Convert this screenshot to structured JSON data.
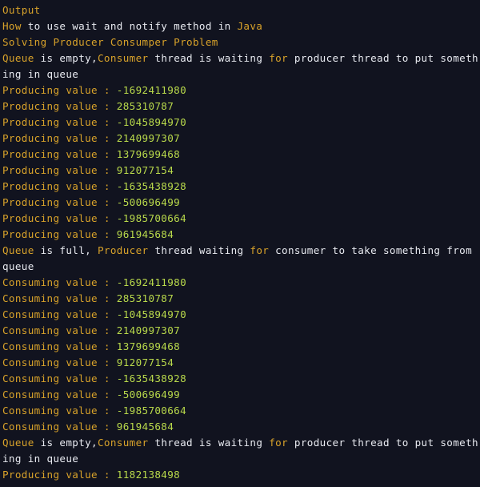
{
  "window": {
    "title": "Output",
    "background_color": "#11131f"
  },
  "colors": {
    "keyword": "#d8a22a",
    "plain": "#e8eaf0",
    "number": "#b9d94b",
    "background": "#11131f"
  },
  "console": {
    "label": "Output",
    "lines": [
      {
        "id": "line-output-label",
        "segments": [
          {
            "text": "Output",
            "style": "key"
          }
        ]
      },
      {
        "id": "line-title",
        "segments": [
          {
            "text": "How",
            "style": "key"
          },
          {
            "text": " to use wait and notify method in ",
            "style": "plain"
          },
          {
            "text": "Java",
            "style": "key"
          }
        ]
      },
      {
        "id": "line-subtitle",
        "segments": [
          {
            "text": "Solving Producer Consumper Problem",
            "style": "key"
          }
        ]
      },
      {
        "id": "line-queue-empty-1",
        "segments": [
          {
            "text": "Queue",
            "style": "key"
          },
          {
            "text": " is empty,",
            "style": "plain"
          },
          {
            "text": "Consumer",
            "style": "key"
          },
          {
            "text": " thread is waiting ",
            "style": "plain"
          },
          {
            "text": "for",
            "style": "key"
          },
          {
            "text": " producer thread to put something in queue",
            "style": "plain"
          }
        ]
      },
      {
        "id": "line-producing-1",
        "segments": [
          {
            "text": "Producing value : ",
            "style": "key"
          },
          {
            "text": "-1692411980",
            "style": "num"
          }
        ]
      },
      {
        "id": "line-producing-2",
        "segments": [
          {
            "text": "Producing value : ",
            "style": "key"
          },
          {
            "text": "285310787",
            "style": "num"
          }
        ]
      },
      {
        "id": "line-producing-3",
        "segments": [
          {
            "text": "Producing value : ",
            "style": "key"
          },
          {
            "text": "-1045894970",
            "style": "num"
          }
        ]
      },
      {
        "id": "line-producing-4",
        "segments": [
          {
            "text": "Producing value : ",
            "style": "key"
          },
          {
            "text": "2140997307",
            "style": "num"
          }
        ]
      },
      {
        "id": "line-producing-5",
        "segments": [
          {
            "text": "Producing value : ",
            "style": "key"
          },
          {
            "text": "1379699468",
            "style": "num"
          }
        ]
      },
      {
        "id": "line-producing-6",
        "segments": [
          {
            "text": "Producing value : ",
            "style": "key"
          },
          {
            "text": "912077154",
            "style": "num"
          }
        ]
      },
      {
        "id": "line-producing-7",
        "segments": [
          {
            "text": "Producing value : ",
            "style": "key"
          },
          {
            "text": "-1635438928",
            "style": "num"
          }
        ]
      },
      {
        "id": "line-producing-8",
        "segments": [
          {
            "text": "Producing value : ",
            "style": "key"
          },
          {
            "text": "-500696499",
            "style": "num"
          }
        ]
      },
      {
        "id": "line-producing-9",
        "segments": [
          {
            "text": "Producing value : ",
            "style": "key"
          },
          {
            "text": "-1985700664",
            "style": "num"
          }
        ]
      },
      {
        "id": "line-producing-10",
        "segments": [
          {
            "text": "Producing value : ",
            "style": "key"
          },
          {
            "text": "961945684",
            "style": "num"
          }
        ]
      },
      {
        "id": "line-queue-full",
        "segments": [
          {
            "text": "Queue",
            "style": "key"
          },
          {
            "text": " is full, ",
            "style": "plain"
          },
          {
            "text": "Producer",
            "style": "key"
          },
          {
            "text": " thread waiting ",
            "style": "plain"
          },
          {
            "text": "for",
            "style": "key"
          },
          {
            "text": " consumer to take something from queue",
            "style": "plain"
          }
        ]
      },
      {
        "id": "line-consuming-1",
        "segments": [
          {
            "text": "Consuming value : ",
            "style": "key"
          },
          {
            "text": "-1692411980",
            "style": "num"
          }
        ]
      },
      {
        "id": "line-consuming-2",
        "segments": [
          {
            "text": "Consuming value : ",
            "style": "key"
          },
          {
            "text": "285310787",
            "style": "num"
          }
        ]
      },
      {
        "id": "line-consuming-3",
        "segments": [
          {
            "text": "Consuming value : ",
            "style": "key"
          },
          {
            "text": "-1045894970",
            "style": "num"
          }
        ]
      },
      {
        "id": "line-consuming-4",
        "segments": [
          {
            "text": "Consuming value : ",
            "style": "key"
          },
          {
            "text": "2140997307",
            "style": "num"
          }
        ]
      },
      {
        "id": "line-consuming-5",
        "segments": [
          {
            "text": "Consuming value : ",
            "style": "key"
          },
          {
            "text": "1379699468",
            "style": "num"
          }
        ]
      },
      {
        "id": "line-consuming-6",
        "segments": [
          {
            "text": "Consuming value : ",
            "style": "key"
          },
          {
            "text": "912077154",
            "style": "num"
          }
        ]
      },
      {
        "id": "line-consuming-7",
        "segments": [
          {
            "text": "Consuming value : ",
            "style": "key"
          },
          {
            "text": "-1635438928",
            "style": "num"
          }
        ]
      },
      {
        "id": "line-consuming-8",
        "segments": [
          {
            "text": "Consuming value : ",
            "style": "key"
          },
          {
            "text": "-500696499",
            "style": "num"
          }
        ]
      },
      {
        "id": "line-consuming-9",
        "segments": [
          {
            "text": "Consuming value : ",
            "style": "key"
          },
          {
            "text": "-1985700664",
            "style": "num"
          }
        ]
      },
      {
        "id": "line-consuming-10",
        "segments": [
          {
            "text": "Consuming value : ",
            "style": "key"
          },
          {
            "text": "961945684",
            "style": "num"
          }
        ]
      },
      {
        "id": "line-queue-empty-2",
        "segments": [
          {
            "text": "Queue",
            "style": "key"
          },
          {
            "text": " is empty,",
            "style": "plain"
          },
          {
            "text": "Consumer",
            "style": "key"
          },
          {
            "text": " thread is waiting ",
            "style": "plain"
          },
          {
            "text": "for",
            "style": "key"
          },
          {
            "text": " producer thread to put something in queue",
            "style": "plain"
          }
        ]
      },
      {
        "id": "line-producing-11",
        "segments": [
          {
            "text": "Producing value : ",
            "style": "key"
          },
          {
            "text": "1182138498",
            "style": "num"
          }
        ]
      }
    ]
  }
}
